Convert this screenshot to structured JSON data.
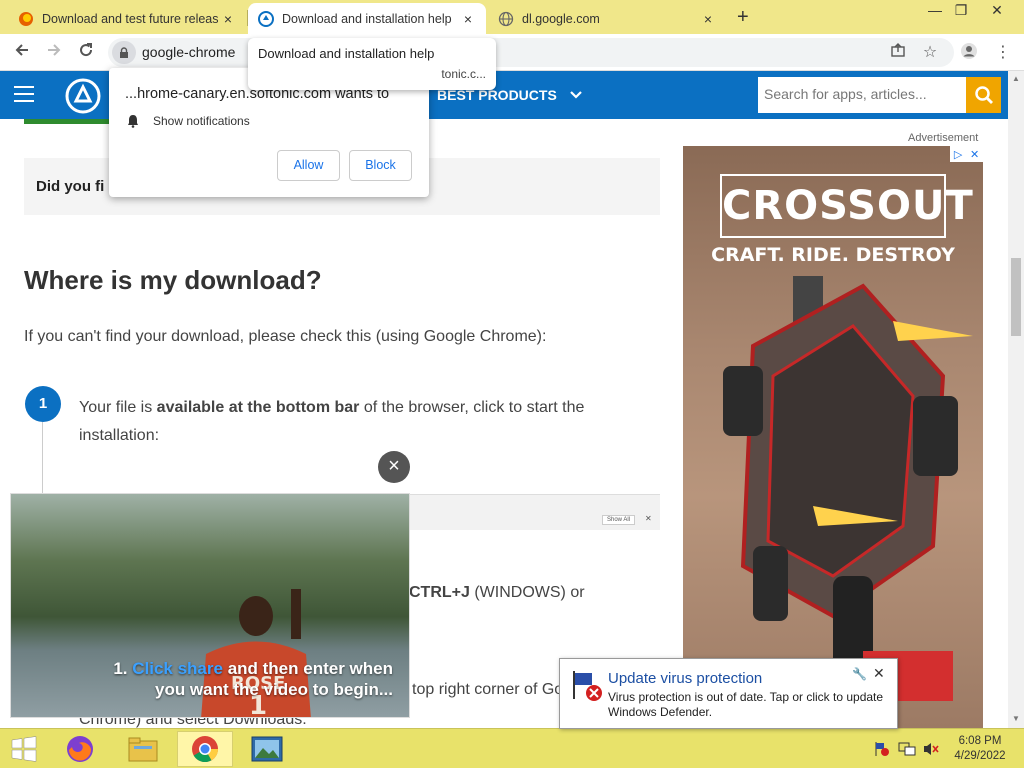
{
  "tabs": [
    {
      "title": "Download and test future releas",
      "close": "×",
      "active": false
    },
    {
      "title": "Download and installation help",
      "close": "×",
      "active": true
    },
    {
      "title": "dl.google.com",
      "close": "×",
      "active": false
    }
  ],
  "new_tab_symbol": "+",
  "window_controls": {
    "minimize": "—",
    "restore": "❐",
    "close": "✕"
  },
  "address_bar": {
    "url": "google-chrome"
  },
  "tab_tooltip": {
    "title": "Download and installation help",
    "domain": "tonic.c..."
  },
  "notification_prompt": {
    "title": "...hrome-canary.en.softonic.com wants to",
    "permission": "Show notifications",
    "allow": "Allow",
    "block": "Block",
    "close": "×"
  },
  "site_header": {
    "nav_label": "BEST PRODUCTS",
    "search_placeholder": "Search for apps, articles..."
  },
  "content": {
    "did_you_find": "Did you fi",
    "heading": "Where is my download?",
    "intro": "If you can't find your download, please check this (using Google Chrome):",
    "step_number": "1",
    "step1_pre": "Your file is ",
    "step1_bold": "available at the bottom bar",
    "step1_post": " of the browser, click to start the installation:",
    "show_all": "Show All",
    "ctrl_bold": "CTRL+J",
    "ctrl_rest": " (WINDOWS) or",
    "top_right": "top right corner of Go",
    "chrome_downloads": "Chrome) and select Downloads."
  },
  "ad": {
    "label": "Advertisement",
    "brand": "CROSSOUT",
    "tagline": "CRAFT. RIDE. DESTROY"
  },
  "video": {
    "close": "×",
    "jersey_name": "ROSE",
    "jersey_number": "1",
    "caption_line1_num": "1. ",
    "caption_line1_highlight": "Click share",
    "caption_line1_rest": " and then enter when",
    "caption_line2": "you want the video to begin..."
  },
  "defender_balloon": {
    "title": "Update virus protection",
    "message": "Virus protection is out of date. Tap or click to update Windows Defender.",
    "close": "✕"
  },
  "taskbar": {
    "time": "6:08 PM",
    "date": "4/29/2022"
  },
  "colors": {
    "tabstrip": "#f0e78a",
    "site_header": "#0b70c2",
    "search_button": "#f0a500",
    "link_blue": "#1a73e8",
    "taskbar": "#e8e26a"
  }
}
